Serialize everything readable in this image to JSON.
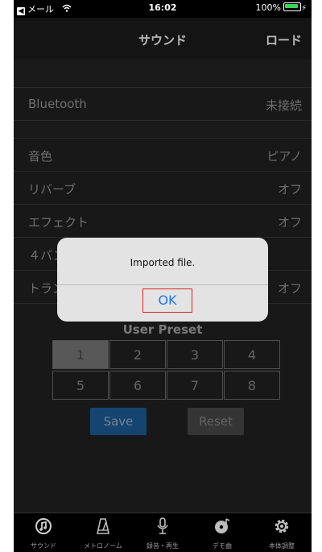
{
  "status_bar": {
    "back_label": "メール",
    "time": "16:02",
    "battery": "100%",
    "icons": [
      "back-arrow-icon",
      "wifi-icon",
      "battery-icon",
      "charging-icon"
    ]
  },
  "nav": {
    "title": "サウンド",
    "right_action": "ロード"
  },
  "settings": [
    {
      "label": "Bluetooth",
      "value": "未接続"
    },
    {
      "label": "音色",
      "value": "ピアノ"
    },
    {
      "label": "リバーブ",
      "value": "オフ"
    },
    {
      "label": "エフェクト",
      "value": "オフ"
    },
    {
      "label": "４バン",
      "value": ""
    },
    {
      "label": "トラン",
      "value": "オフ"
    }
  ],
  "user_preset": {
    "title": "User Preset",
    "slots": [
      "1",
      "2",
      "3",
      "4",
      "5",
      "6",
      "7",
      "8"
    ],
    "selected": "1"
  },
  "buttons": {
    "save": "Save",
    "reset": "Reset"
  },
  "alert": {
    "message": "Imported file.",
    "ok": "OK"
  },
  "tabs": [
    {
      "label": "サウンド",
      "icon": "sound-icon"
    },
    {
      "label": "メトロノーム",
      "icon": "metronome-icon"
    },
    {
      "label": "録音・再生",
      "icon": "microphone-icon"
    },
    {
      "label": "デモ曲",
      "icon": "demo-song-icon"
    },
    {
      "label": "本体調整",
      "icon": "gear-icon"
    }
  ],
  "colors": {
    "accent_save": "#1d5f9a",
    "alert_ok": "#2276e6",
    "highlight_border": "#e02020",
    "battery": "#3cd35a"
  }
}
